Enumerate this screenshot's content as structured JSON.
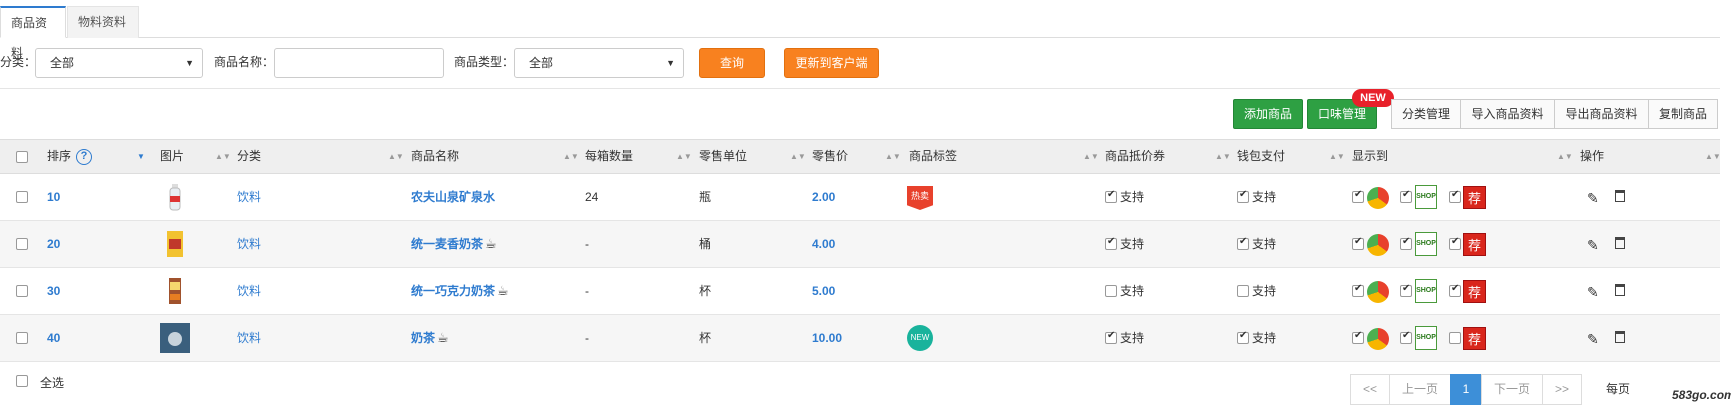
{
  "tabs": [
    {
      "label": "商品资料",
      "active": true
    },
    {
      "label": "物料资料",
      "active": false
    }
  ],
  "filters": {
    "category_label": "分类：",
    "category_value": "全部",
    "name_label": "商品名称：",
    "name_value": "",
    "type_label": "商品类型：",
    "type_value": "全部",
    "query_button": "查询",
    "update_button": "更新到客户端"
  },
  "actions": {
    "add_product": "添加商品",
    "taste_manage": "口味管理",
    "new_badge": "NEW",
    "category_manage": "分类管理",
    "import": "导入商品资料",
    "export": "导出商品资料",
    "copy": "复制商品"
  },
  "table": {
    "headers": {
      "order": "排序",
      "image": "图片",
      "category": "分类",
      "name": "商品名称",
      "box_qty": "每箱数量",
      "unit": "零售单位",
      "price": "零售价",
      "tag": "商品标签",
      "voucher": "商品抵价券",
      "wallet": "钱包支付",
      "display": "显示到",
      "ops": "操作"
    },
    "rows": [
      {
        "order": "10",
        "category": "饮料",
        "name": "农夫山泉矿泉水",
        "box_qty": "24",
        "unit": "瓶",
        "price": "2.00",
        "tag": "热卖",
        "voucher": "支持",
        "voucher_on": true,
        "wallet": "支持",
        "wallet_on": true,
        "has_taste": false,
        "disp": [
          true,
          true,
          true
        ]
      },
      {
        "order": "20",
        "category": "饮料",
        "name": "统一麦香奶茶",
        "box_qty": "-",
        "unit": "桶",
        "price": "4.00",
        "tag": "",
        "voucher": "支持",
        "voucher_on": true,
        "wallet": "支持",
        "wallet_on": true,
        "has_taste": true,
        "disp": [
          true,
          true,
          true
        ]
      },
      {
        "order": "30",
        "category": "饮料",
        "name": "统一巧克力奶茶",
        "box_qty": "-",
        "unit": "杯",
        "price": "5.00",
        "tag": "",
        "voucher": "支持",
        "voucher_on": false,
        "wallet": "支持",
        "wallet_on": false,
        "has_taste": true,
        "disp": [
          true,
          true,
          true
        ]
      },
      {
        "order": "40",
        "category": "饮料",
        "name": "奶茶",
        "box_qty": "-",
        "unit": "杯",
        "price": "10.00",
        "tag": "NEW",
        "voucher": "支持",
        "voucher_on": true,
        "wallet": "支持",
        "wallet_on": true,
        "has_taste": true,
        "disp": [
          true,
          true,
          false
        ]
      }
    ],
    "recommend_glyph": "荐",
    "shop_glyph": "SHOP"
  },
  "footer": {
    "select_all": "全选",
    "first": "<<",
    "prev": "上一页",
    "current_page": "1",
    "next": "下一页",
    "last": ">>",
    "per_page": "每页",
    "watermark": "583go.com"
  },
  "colors": {
    "orange": "#f8811f",
    "green": "#2ea043",
    "link_blue": "#2e7bcf",
    "badge_red": "#e8212a"
  }
}
